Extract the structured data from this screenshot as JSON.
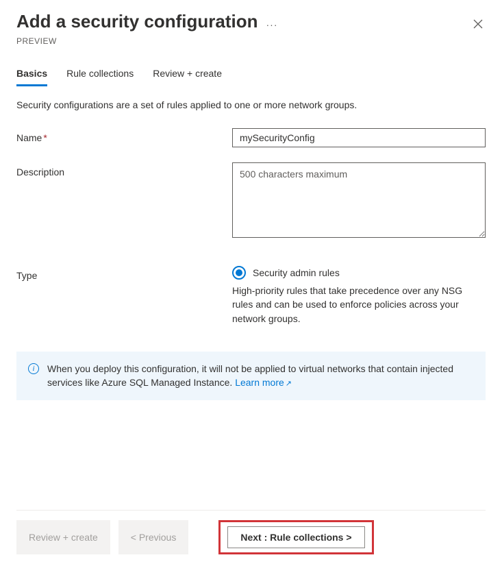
{
  "header": {
    "title": "Add a security configuration",
    "preview_label": "PREVIEW"
  },
  "tabs": [
    {
      "label": "Basics",
      "active": true
    },
    {
      "label": "Rule collections",
      "active": false
    },
    {
      "label": "Review + create",
      "active": false
    }
  ],
  "intro": "Security configurations are a set of rules applied to one or more network groups.",
  "form": {
    "name": {
      "label": "Name",
      "value": "mySecurityConfig",
      "required": true
    },
    "description": {
      "label": "Description",
      "placeholder": "500 characters maximum"
    },
    "type": {
      "label": "Type",
      "option_label": "Security admin rules",
      "option_description": "High-priority rules that take precedence over any NSG rules and can be used to enforce policies across your network groups."
    }
  },
  "info": {
    "text": "When you deploy this configuration, it will not be applied to virtual networks that contain injected services like Azure SQL Managed Instance. ",
    "link_text": "Learn more"
  },
  "footer": {
    "review_label": "Review + create",
    "previous_label": "< Previous",
    "next_label": "Next : Rule collections >"
  }
}
